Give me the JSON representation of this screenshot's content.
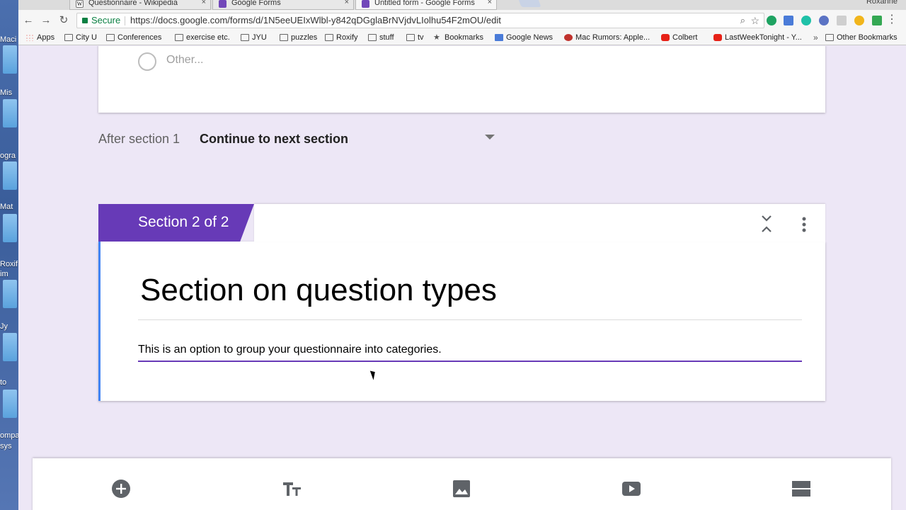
{
  "desktop": {
    "items": [
      "Maci",
      "Mis",
      "ogra",
      "Mat",
      "Roxif",
      "im",
      "Jy",
      "to",
      "ompa",
      "sys"
    ]
  },
  "browser": {
    "tabs": [
      {
        "title": "Questionnaire - Wikipedia",
        "close": "×"
      },
      {
        "title": "Google Forms",
        "close": "×"
      },
      {
        "title": "Untitled form - Google Forms",
        "close": "×"
      }
    ],
    "user": "Roxanne",
    "secure_label": "Secure",
    "url": "https://docs.google.com/forms/d/1N5eeUEIxWlbl-y842qDGglaBrNVjdvLIolhu54F2mOU/edit",
    "bookmarks": [
      "Apps",
      "City U",
      "Conferences",
      "exercise etc.",
      "JYU",
      "puzzles",
      "Roxify",
      "stuff",
      "tv",
      "Bookmarks",
      "Google News",
      "Mac Rumors: Apple...",
      "Colbert",
      "LastWeekTonight - Y..."
    ],
    "bookmarks_more": "»",
    "other_bookmarks": "Other Bookmarks"
  },
  "form": {
    "other_option": "Other...",
    "after_section_label": "After section 1",
    "after_section_value": "Continue to next section",
    "section_badge": "Section 2 of 2",
    "section_title": "Section on question types",
    "section_description": "This is an option to group your questionnaire into categories."
  },
  "toolbar_icons": [
    "add-question-icon",
    "title-text-icon",
    "image-icon",
    "video-icon",
    "section-icon"
  ],
  "colors": {
    "accent": "#673ab7",
    "page_bg": "#ede7f6",
    "section_border": "#4285f4"
  }
}
